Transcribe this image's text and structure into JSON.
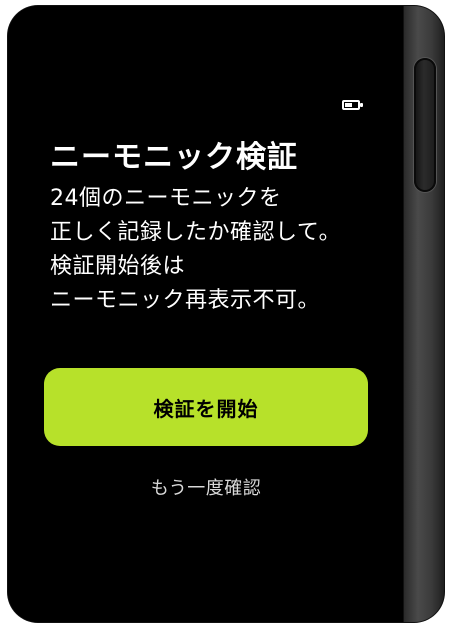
{
  "status": {
    "battery_icon": "battery-icon",
    "battery_level_percent": 60
  },
  "screen": {
    "title": "ニーモニック検証",
    "message_lines": [
      "24個のニーモニックを",
      "正しく記録したか確認して。",
      "検証開始後は",
      "ニーモニック再表示不可。"
    ]
  },
  "actions": {
    "primary_label": "検証を開始",
    "secondary_label": "もう一度確認"
  },
  "colors": {
    "accent": "#b7e12a",
    "background": "#000000",
    "text": "#ffffff"
  }
}
